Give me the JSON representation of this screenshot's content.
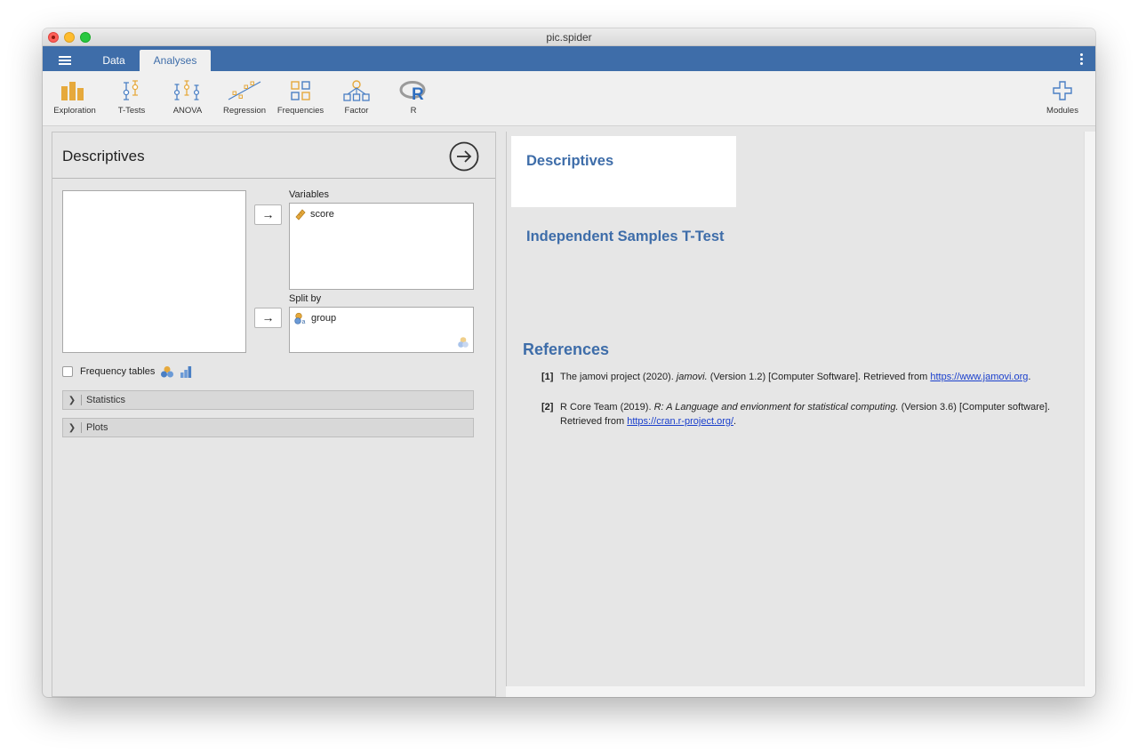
{
  "window": {
    "title": "pic.spider"
  },
  "menu": {
    "tabs": [
      "Data",
      "Analyses"
    ]
  },
  "ribbon": {
    "tools": [
      {
        "label": "Exploration",
        "icon": "exploration-icon"
      },
      {
        "label": "T-Tests",
        "icon": "t-tests-icon"
      },
      {
        "label": "ANOVA",
        "icon": "anova-icon"
      },
      {
        "label": "Regression",
        "icon": "regression-icon"
      },
      {
        "label": "Frequencies",
        "icon": "frequencies-icon"
      },
      {
        "label": "Factor",
        "icon": "factor-icon"
      },
      {
        "label": "R",
        "icon": "r-icon"
      }
    ],
    "modules": {
      "label": "Modules",
      "icon": "plus-icon"
    }
  },
  "options": {
    "title": "Descriptives",
    "variables_label": "Variables",
    "variables": [
      "score"
    ],
    "split_label": "Split by",
    "split": [
      "group"
    ],
    "frequency_tables_label": "Frequency tables",
    "sections": [
      "Statistics",
      "Plots"
    ]
  },
  "results": {
    "descriptives_heading": "Descriptives",
    "ttest_heading": "Independent Samples T-Test",
    "references_heading": "References",
    "references": [
      {
        "num": "[1]",
        "pre": "The jamovi project (2020). ",
        "italic": "jamovi.",
        "post": " (Version 1.2) [Computer Software]. Retrieved from ",
        "link": "https://www.jamovi.org",
        "end": "."
      },
      {
        "num": "[2]",
        "pre": "R Core Team (2019). ",
        "italic": "R: A Language and envionment for statistical computing.",
        "post": " (Version 3.6) [Computer software]. Retrieved from ",
        "link": "https://cran.r-project.org/",
        "end": "."
      }
    ]
  },
  "colors": {
    "accent": "#3e6da9",
    "heading": "#3e6da9",
    "link": "#1a3fcc",
    "tool_orange": "#e6a93c",
    "tool_blue": "#4a7fc4"
  }
}
